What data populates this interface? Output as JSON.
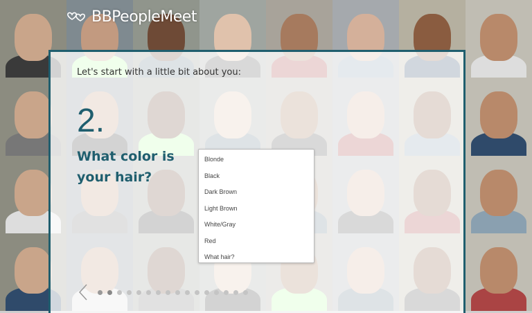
{
  "brand": {
    "name": "BBPeopleMeet",
    "accent": "#1f5e6e"
  },
  "step": {
    "intro": "Let's start with a little bit about you:",
    "number": "2.",
    "question": "What color is your hair?"
  },
  "hair_options": [
    "Blonde",
    "Black",
    "Dark Brown",
    "Light Brown",
    "White/Gray",
    "Red",
    "What hair?"
  ],
  "pager": {
    "total_dots": 16,
    "current": 2
  },
  "icons": {
    "prev": "chevron-left-icon",
    "logo": "hearts-icon"
  }
}
